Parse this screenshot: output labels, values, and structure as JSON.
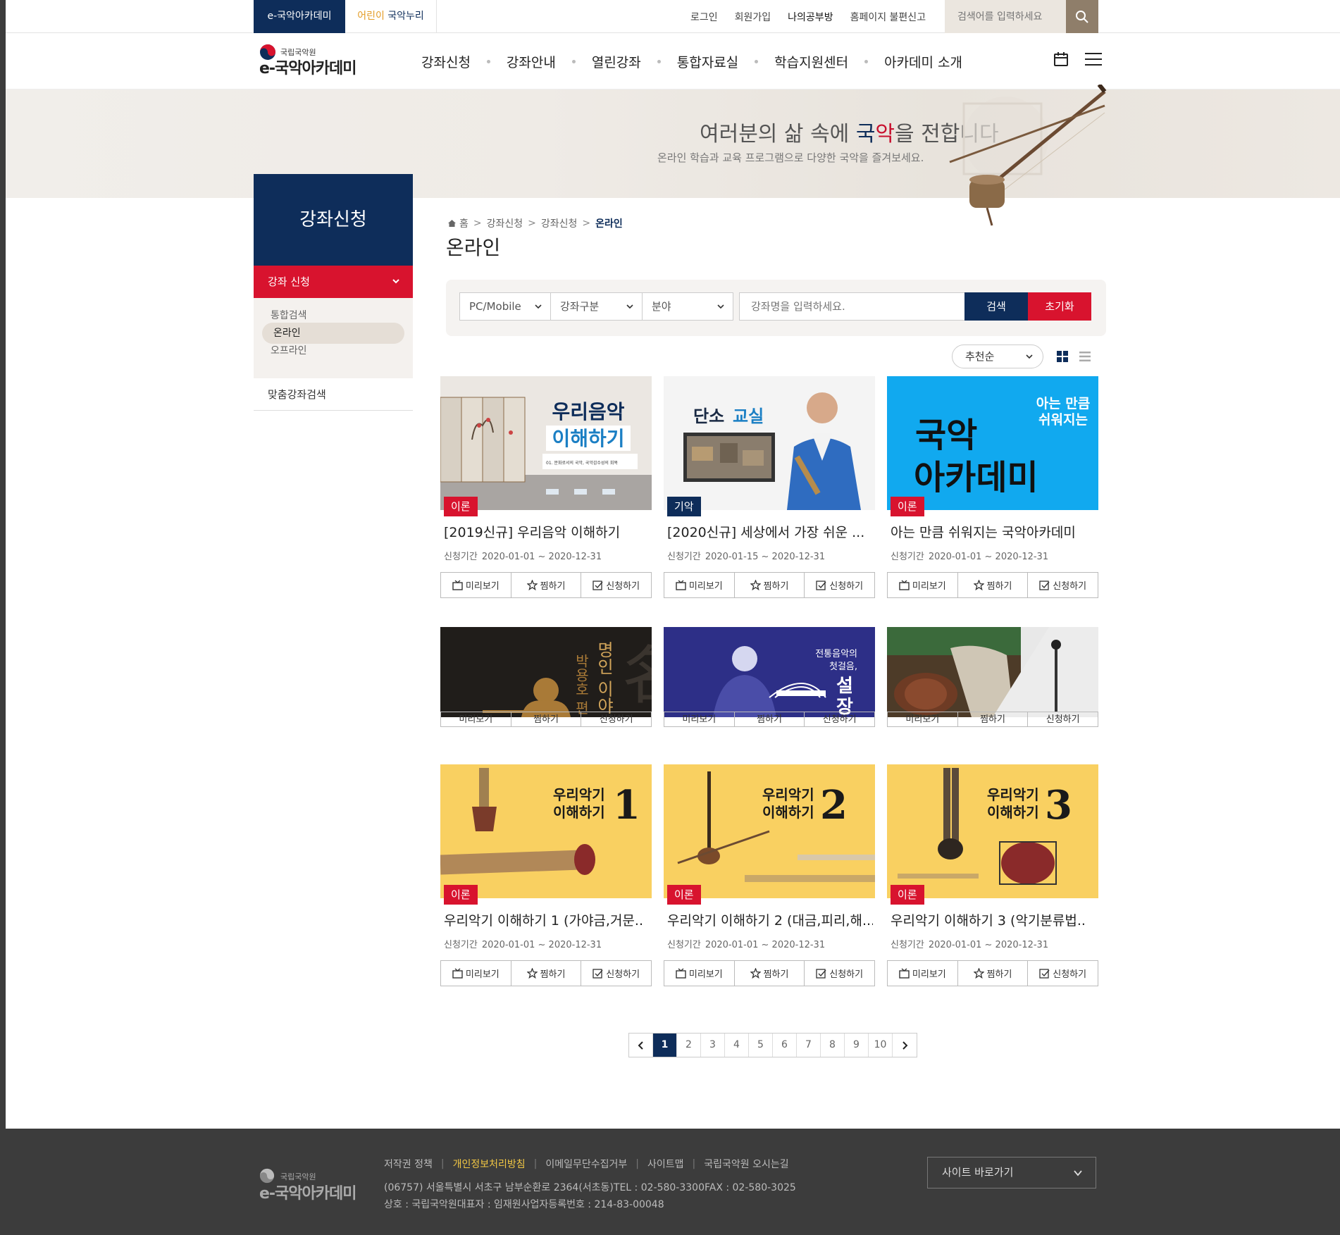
{
  "top_bar": {
    "site_tabs": [
      "e-국악아카데미",
      "어린이 국악누리"
    ],
    "site_tab_alt_parts": [
      "어린이",
      " 국악누리"
    ],
    "links": [
      "로그인",
      "회원가입",
      "나의공부방",
      "홈페이지 불편신고"
    ],
    "search_placeholder": "검색어를 입력하세요"
  },
  "header": {
    "logo_small": "국립국악원",
    "logo_big": "e-국악아카데미",
    "menu": [
      "강좌신청",
      "강좌안내",
      "열린강좌",
      "통합자료실",
      "학습지원센터",
      "아카데미 소개"
    ]
  },
  "banner": {
    "title_parts": [
      "여러분의 삶 속에 ",
      "국",
      "악",
      "을 전합니다"
    ],
    "subtitle": "온라인 학습과 교육 프로그램으로 다양한 국악을 즐겨보세요."
  },
  "sidebar": {
    "heading": "강좌신청",
    "selected": "강좌 신청",
    "sub_items": [
      "통합검색",
      "온라인",
      "오프라인"
    ],
    "other_item": "맞춤강좌검색"
  },
  "breadcrumb": [
    "홈",
    "강좌신청",
    "강좌신청",
    "온라인"
  ],
  "page_title": "온라인",
  "filters": {
    "device": "PC/Mobile",
    "category": "강좌구분",
    "field": "분야",
    "keyword_placeholder": "강좌명을 입력하세요.",
    "search_label": "검색",
    "reset_label": "초기화",
    "sort": "추천순"
  },
  "card_labels": {
    "period_label": "신청기간",
    "preview": "미리보기",
    "wish": "찜하기",
    "apply": "신청하기"
  },
  "courses": [
    {
      "badge": "이론",
      "title": "[2019신규] 우리음악 이해하기",
      "period": "2020-01-01 ~ 2020-12-31",
      "thumb_text": [
        "우리음악",
        "이해하기",
        "01. 문화로서의 국악, 국악감수성의 회복"
      ]
    },
    {
      "badge": "기악",
      "title": "[2020신규] 세상에서 가장 쉬운 ...",
      "period": "2020-01-15 ~ 2020-12-31",
      "thumb_text": [
        "단소",
        "교실"
      ]
    },
    {
      "badge": "이론",
      "title": "아는 만큼 쉬워지는 국악아카데미",
      "period": "2020-01-01 ~ 2020-12-31",
      "thumb_text": [
        "아는 만큼",
        "쉬워지는",
        "국악",
        "아카데미"
      ]
    },
    {
      "badge": "",
      "title": "",
      "period": "",
      "thumb_text": [
        "박용호 편",
        "명인 이야"
      ]
    },
    {
      "badge": "",
      "title": "",
      "period": "",
      "thumb_text": [
        "전통음악의",
        "첫걸음,",
        "설",
        "장"
      ]
    },
    {
      "badge": "",
      "title": "",
      "period": "",
      "thumb_text": []
    },
    {
      "badge": "이론",
      "title": "우리악기 이해하기 1 (가야금,거문..",
      "period": "2020-01-01 ~ 2020-12-31",
      "thumb_text": [
        "우리악기",
        "이해하기",
        "1"
      ]
    },
    {
      "badge": "이론",
      "title": "우리악기 이해하기 2 (대금,피리,해...",
      "period": "2020-01-01 ~ 2020-12-31",
      "thumb_text": [
        "우리악기",
        "이해하기",
        "2"
      ]
    },
    {
      "badge": "이론",
      "title": "우리악기 이해하기 3 (악기분류법..",
      "period": "2020-01-01 ~ 2020-12-31",
      "thumb_text": [
        "우리악기",
        "이해하기",
        "3"
      ]
    }
  ],
  "pagination": {
    "pages": [
      "1",
      "2",
      "3",
      "4",
      "5",
      "6",
      "7",
      "8",
      "9",
      "10"
    ],
    "current": "1"
  },
  "footer": {
    "logo_small": "국립국악원",
    "logo_big": "e-국악아카데미",
    "links": [
      "저작권 정책",
      "개인정보처리방침",
      "이메일무단수집거부",
      "사이트맵",
      "국립국악원 오시는길"
    ],
    "address": "(06757) 서울특별시 서초구 남부순환로 2364(서초동)TEL : 02-580-3300FAX : 02-580-3025",
    "corp": "상호 : 국립국악원대표자 : 임재원사업자등록번호 : 214-83-00048",
    "site_shortcut": "사이트 바로가기"
  },
  "colors": {
    "navy": "#0e2d5a",
    "red": "#d8132e",
    "sky": "#11a9ef",
    "yellow": "#f9d061",
    "footer": "#3c3c3c",
    "highlight": "#f2c744"
  }
}
